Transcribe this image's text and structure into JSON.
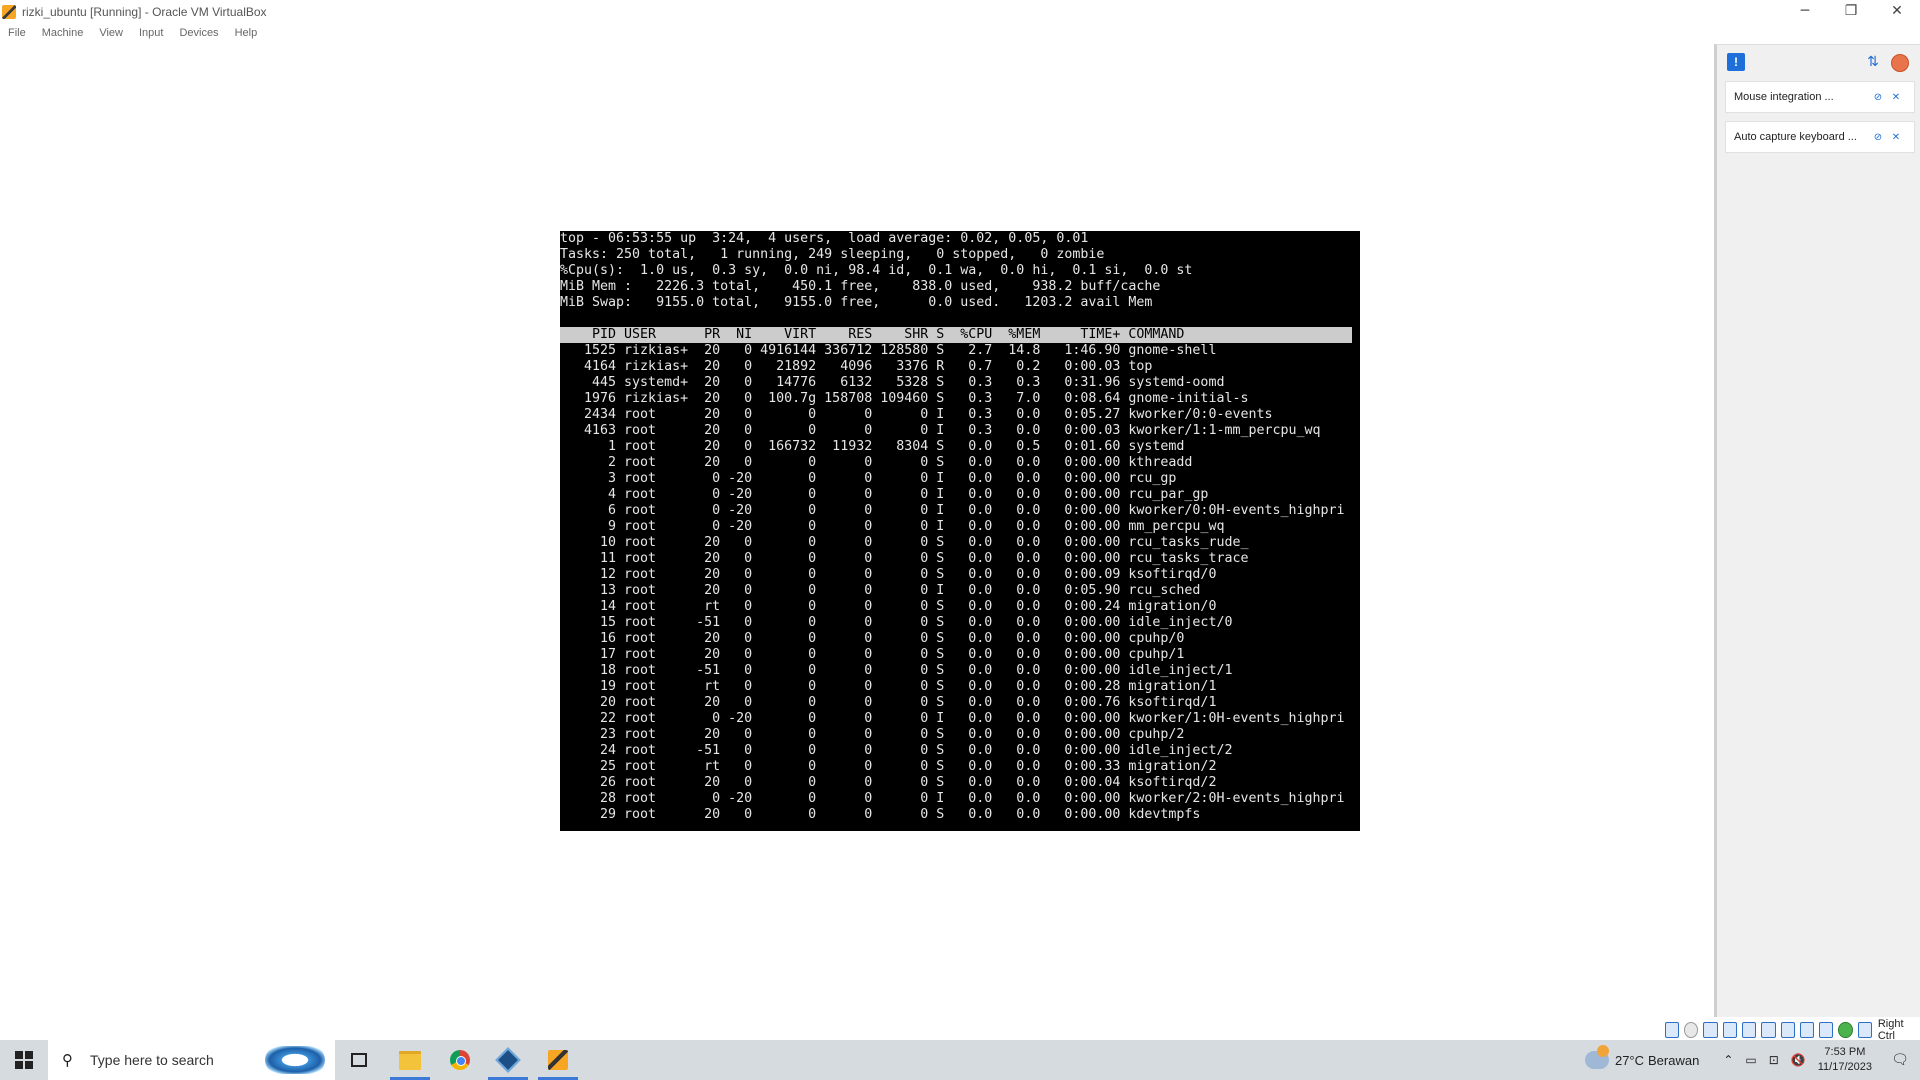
{
  "window": {
    "title": "rizki_ubuntu [Running] - Oracle VM VirtualBox",
    "controls": {
      "minimize": "─",
      "restore": "❐",
      "close": "✕"
    }
  },
  "menu": [
    "File",
    "Machine",
    "View",
    "Input",
    "Devices",
    "Help"
  ],
  "terminal": {
    "summary": [
      "top - 06:53:55 up  3:24,  4 users,  load average: 0.02, 0.05, 0.01",
      "Tasks: 250 total,   1 running, 249 sleeping,   0 stopped,   0 zombie",
      "%Cpu(s):  1.0 us,  0.3 sy,  0.0 ni, 98.4 id,  0.1 wa,  0.0 hi,  0.1 si,  0.0 st",
      "MiB Mem :   2226.3 total,    450.1 free,    838.0 used,    938.2 buff/cache",
      "MiB Swap:   9155.0 total,   9155.0 free,      0.0 used.   1203.2 avail Mem"
    ],
    "header": "    PID USER      PR  NI    VIRT    RES    SHR S  %CPU  %MEM     TIME+ COMMAND",
    "processes": [
      "   1525 rizkias+  20   0 4916144 336712 128580 S   2.7  14.8   1:46.90 gnome-shell",
      "   4164 rizkias+  20   0   21892   4096   3376 R   0.7   0.2   0:00.03 top",
      "    445 systemd+  20   0   14776   6132   5328 S   0.3   0.3   0:31.96 systemd-oomd",
      "   1976 rizkias+  20   0  100.7g 158708 109460 S   0.3   7.0   0:08.64 gnome-initial-s",
      "   2434 root      20   0       0      0      0 I   0.3   0.0   0:05.27 kworker/0:0-events",
      "   4163 root      20   0       0      0      0 I   0.3   0.0   0:00.03 kworker/1:1-mm_percpu_wq",
      "      1 root      20   0  166732  11932   8304 S   0.0   0.5   0:01.60 systemd",
      "      2 root      20   0       0      0      0 S   0.0   0.0   0:00.00 kthreadd",
      "      3 root       0 -20       0      0      0 I   0.0   0.0   0:00.00 rcu_gp",
      "      4 root       0 -20       0      0      0 I   0.0   0.0   0:00.00 rcu_par_gp",
      "      6 root       0 -20       0      0      0 I   0.0   0.0   0:00.00 kworker/0:0H-events_highpri",
      "      9 root       0 -20       0      0      0 I   0.0   0.0   0:00.00 mm_percpu_wq",
      "     10 root      20   0       0      0      0 S   0.0   0.0   0:00.00 rcu_tasks_rude_",
      "     11 root      20   0       0      0      0 S   0.0   0.0   0:00.00 rcu_tasks_trace",
      "     12 root      20   0       0      0      0 S   0.0   0.0   0:00.09 ksoftirqd/0",
      "     13 root      20   0       0      0      0 I   0.0   0.0   0:05.90 rcu_sched",
      "     14 root      rt   0       0      0      0 S   0.0   0.0   0:00.24 migration/0",
      "     15 root     -51   0       0      0      0 S   0.0   0.0   0:00.00 idle_inject/0",
      "     16 root      20   0       0      0      0 S   0.0   0.0   0:00.00 cpuhp/0",
      "     17 root      20   0       0      0      0 S   0.0   0.0   0:00.00 cpuhp/1",
      "     18 root     -51   0       0      0      0 S   0.0   0.0   0:00.00 idle_inject/1",
      "     19 root      rt   0       0      0      0 S   0.0   0.0   0:00.28 migration/1",
      "     20 root      20   0       0      0      0 S   0.0   0.0   0:00.76 ksoftirqd/1",
      "     22 root       0 -20       0      0      0 I   0.0   0.0   0:00.00 kworker/1:0H-events_highpri",
      "     23 root      20   0       0      0      0 S   0.0   0.0   0:00.00 cpuhp/2",
      "     24 root     -51   0       0      0      0 S   0.0   0.0   0:00.00 idle_inject/2",
      "     25 root      rt   0       0      0      0 S   0.0   0.0   0:00.33 migration/2",
      "     26 root      20   0       0      0      0 S   0.0   0.0   0:00.04 ksoftirqd/2",
      "     28 root       0 -20       0      0      0 I   0.0   0.0   0:00.00 kworker/2:0H-events_highpri",
      "     29 root      20   0       0      0      0 S   0.0   0.0   0:00.00 kdevtmpfs"
    ]
  },
  "notifications": {
    "mouse": "Mouse integration ...",
    "keyboard": "Auto capture keyboard ..."
  },
  "statusbar": {
    "host_key": "Right Ctrl"
  },
  "taskbar": {
    "search_placeholder": "Type here to search",
    "weather_temp": "27°C",
    "weather_desc": "Berawan",
    "time": "7:53 PM",
    "date": "11/17/2023"
  },
  "colors": {
    "terminal_bg": "#000000",
    "terminal_fg": "#e6e6e6",
    "header_bg": "#cccccc",
    "accent": "#1e6fd9"
  },
  "icons": {
    "start": "windows-logo-icon",
    "search": "search-icon",
    "taskview": "task-view-icon",
    "explorer": "folder-icon",
    "chrome": "chrome-icon",
    "virtualbox": "virtualbox-icon",
    "vm": "vm-window-icon"
  }
}
